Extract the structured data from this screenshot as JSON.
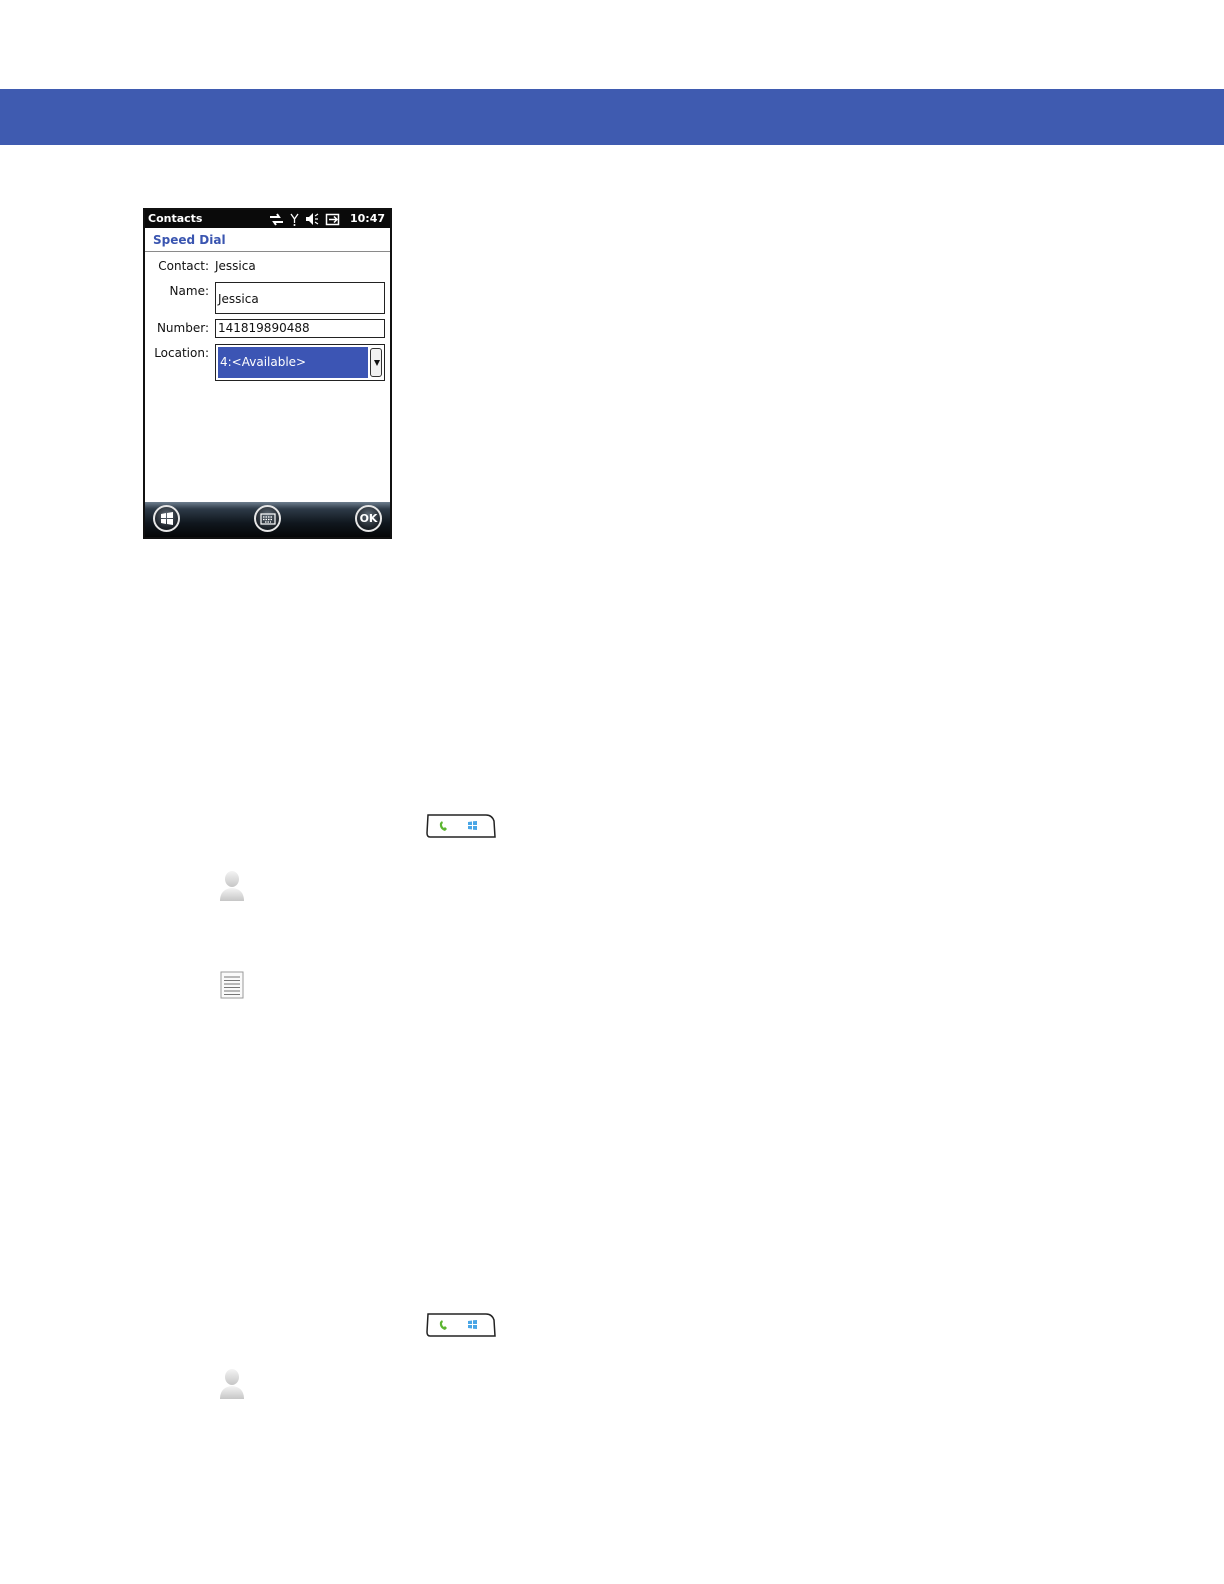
{
  "phone": {
    "status_bar": {
      "app_title": "Contacts",
      "time": "10:47"
    },
    "subtitle": "Speed Dial",
    "contact": {
      "label": "Contact:",
      "value": "Jessica"
    },
    "name": {
      "label": "Name:",
      "value": "Jessica"
    },
    "number": {
      "label": "Number:",
      "value": "141819890488"
    },
    "location": {
      "label": "Location:",
      "value": "4:<Available>"
    },
    "menu_bar": {
      "start_icon": "windows-start-icon",
      "keyboard_icon": "keyboard-icon",
      "ok_label": "OK"
    }
  },
  "icons": [
    "phone-windows-key-icon",
    "contacts-person-icon",
    "notes-list-icon"
  ],
  "colors": {
    "header_band": "#3f5bb0",
    "selection": "#3c55b4",
    "subtitle": "#3a55b0"
  }
}
